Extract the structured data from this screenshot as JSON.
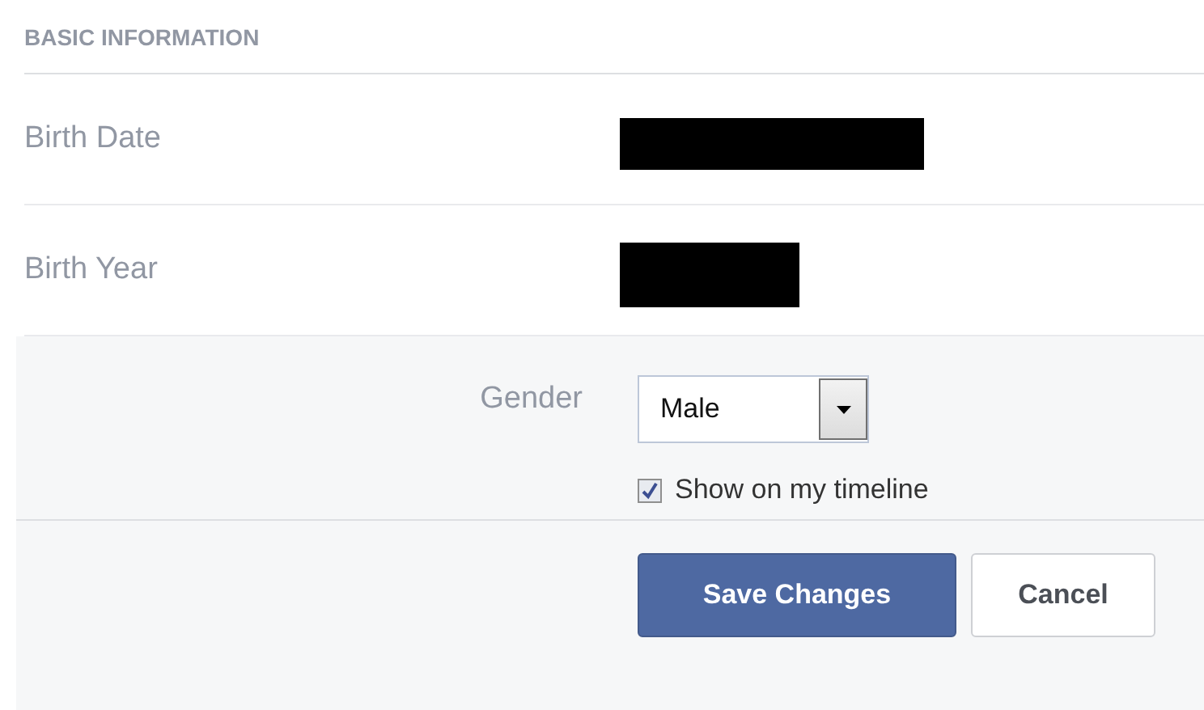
{
  "section": {
    "title": "BASIC INFORMATION"
  },
  "fields": [
    {
      "label": "Birth Date",
      "kind": "redacted-long"
    },
    {
      "label": "Birth Year",
      "kind": "redacted-short"
    }
  ],
  "gender": {
    "label": "Gender",
    "value": "Male"
  },
  "timeline": {
    "label": "Show on my timeline",
    "checked": true
  },
  "buttons": [
    {
      "label": "Save Changes",
      "kind": "primary"
    },
    {
      "label": "Cancel",
      "kind": "secondary"
    }
  ]
}
